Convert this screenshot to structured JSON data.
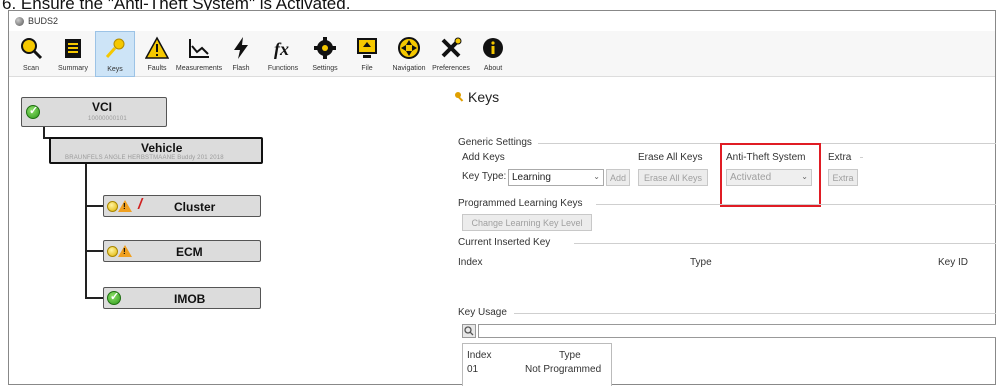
{
  "caption": "6. Ensure the \"Anti-Theft System\" is Activated.",
  "window": {
    "title": "BUDS2"
  },
  "toolbar": [
    {
      "label": "Scan",
      "icon": "magnify-scan-icon"
    },
    {
      "label": "Summary",
      "icon": "clipboard-icon"
    },
    {
      "label": "Keys",
      "icon": "key-icon",
      "active": true
    },
    {
      "label": "Faults",
      "icon": "warning-triangle-icon"
    },
    {
      "label": "Measurements",
      "icon": "graph-icon"
    },
    {
      "label": "Flash",
      "icon": "lightning-icon"
    },
    {
      "label": "Functions",
      "icon": "fx-icon"
    },
    {
      "label": "Settings",
      "icon": "gear-icon"
    },
    {
      "label": "File",
      "icon": "file-icon"
    },
    {
      "label": "Navigation",
      "icon": "navigation-arrows-icon"
    },
    {
      "label": "Preferences",
      "icon": "tools-icon"
    },
    {
      "label": "About",
      "icon": "info-icon"
    }
  ],
  "tree": {
    "vci": {
      "title": "VCI",
      "sub": "10000000101"
    },
    "vehicle": {
      "title": "Vehicle",
      "sub": "BRAUNFELS ANGLE HERBSTMAANE Buddy 201 2018"
    },
    "modules": [
      {
        "title": "Cluster",
        "status": "warning-fault"
      },
      {
        "title": "ECM",
        "status": "warning"
      },
      {
        "title": "IMOB",
        "status": "ok"
      }
    ]
  },
  "keys_panel": {
    "title": "Keys",
    "generic_settings": "Generic Settings",
    "add_keys": {
      "heading": "Add Keys",
      "key_type_label": "Key Type:",
      "key_type_value": "Learning",
      "add_button": "Add"
    },
    "erase_all_keys": {
      "heading": "Erase All Keys",
      "button": "Erase All Keys"
    },
    "anti_theft": {
      "heading": "Anti-Theft System",
      "value": "Activated",
      "highlight_color": "#e01c24"
    },
    "extra": {
      "heading": "Extra",
      "button": "Extra"
    },
    "programmed_learning_keys": {
      "heading": "Programmed Learning Keys",
      "button": "Change Learning Key Level"
    },
    "current_inserted_key": {
      "heading": "Current Inserted Key",
      "columns": [
        "Index",
        "Type",
        "Key ID"
      ]
    },
    "key_usage": {
      "heading": "Key Usage",
      "columns": [
        "Index",
        "Type"
      ],
      "rows": [
        {
          "index": "01",
          "type": "Not Programmed"
        }
      ]
    }
  }
}
